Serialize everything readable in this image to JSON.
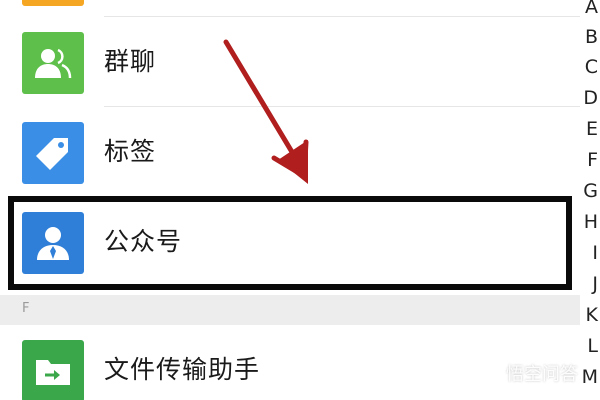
{
  "list": {
    "items": [
      {
        "label": "群聊",
        "icon": "group-chat-icon",
        "color": "#5ec04a"
      },
      {
        "label": "标签",
        "icon": "tag-icon",
        "color": "#3a8ee6"
      },
      {
        "label": "公众号",
        "icon": "official-account-icon",
        "color": "#2f7fd8"
      },
      {
        "label": "文件传输助手",
        "icon": "file-transfer-icon",
        "color": "#3aa84a"
      }
    ]
  },
  "section_header": "F",
  "index_letters": [
    "A",
    "B",
    "C",
    "D",
    "E",
    "F",
    "G",
    "H",
    "I",
    "J",
    "K",
    "L",
    "M"
  ],
  "watermark": "悟空问答",
  "colors": {
    "arrow": "#b01e1e",
    "highlight": "#0a0a0a"
  }
}
